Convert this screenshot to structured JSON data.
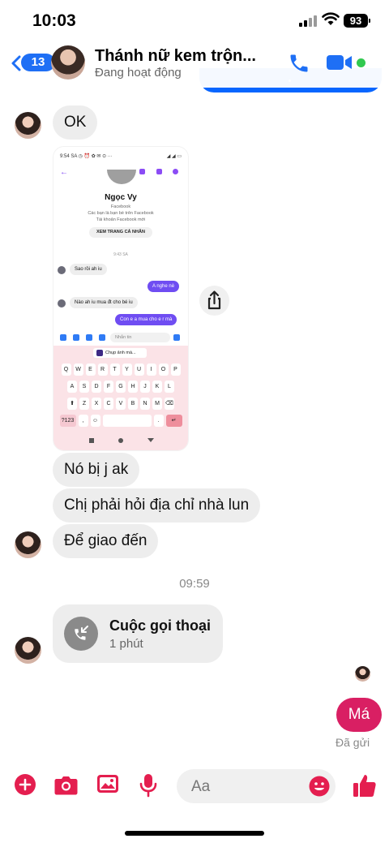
{
  "status_bar": {
    "time": "10:03",
    "battery": "93"
  },
  "header": {
    "unread_count": "13",
    "contact_name": "Thánh nữ kem trộn...",
    "presence": "Đang hoạt động"
  },
  "messages": [
    {
      "id": "ok",
      "text": "OK"
    },
    {
      "id": "m1",
      "text": "Nó bị j ak"
    },
    {
      "id": "m2",
      "text": "Chị phải hỏi địa chỉ nhà lun"
    },
    {
      "id": "m3",
      "text": "Để giao đến"
    }
  ],
  "shared_image": {
    "status_left": "9:54 SA ◷ ⏰ ✿ ✉ ⊙ ···",
    "status_right": "◢ ◢ ▭",
    "profile_name": "Ngọc Vy",
    "profile_sub1": "Facebook",
    "profile_sub2": "Các bạn là bạn bè trên Facebook",
    "profile_sub3": "Tài khoản Facebook mới",
    "profile_button": "XEM TRANG CÁ NHÂN",
    "time": "9:43 SA",
    "msg_in_1": "Sao rồi ah iu",
    "msg_out_1": "A nghe nè",
    "msg_in_2": "Nào ah iu mua đt cho bé iu",
    "msg_out_2": "Con e a mua cho e r mà",
    "input_placeholder": "Nhắn tin",
    "kb_suggestion": "Chụp ảnh mà...",
    "kb_row1": [
      "Q",
      "W",
      "E",
      "R",
      "T",
      "Y",
      "U",
      "I",
      "O",
      "P"
    ],
    "kb_row2": [
      "A",
      "S",
      "D",
      "F",
      "G",
      "H",
      "J",
      "K",
      "L"
    ],
    "kb_row3": [
      "⬆",
      "Z",
      "X",
      "C",
      "V",
      "B",
      "N",
      "M",
      "⌫"
    ],
    "kb_row4_left": "?123",
    "kb_row4_comma": ",",
    "kb_row4_emoji": "☺",
    "kb_row4_dot": ".",
    "kb_row4_enter": "↵"
  },
  "time_separator": "09:59",
  "call": {
    "title": "Cuộc gọi thoại",
    "duration": "1 phút"
  },
  "sent_message": {
    "text": "Má",
    "status": "Đã gửi"
  },
  "composer": {
    "placeholder": "Aa"
  },
  "colors": {
    "accent": "#0866ff",
    "sent_bubble": "#d91f63",
    "online": "#31c950",
    "action_icons": "#e41e4f"
  },
  "icons": [
    "back-chevron-icon",
    "phone-icon",
    "video-icon",
    "share-icon",
    "call-missed-icon",
    "plus-icon",
    "camera-icon",
    "image-icon",
    "microphone-icon",
    "emoji-icon",
    "thumbs-up-icon"
  ]
}
